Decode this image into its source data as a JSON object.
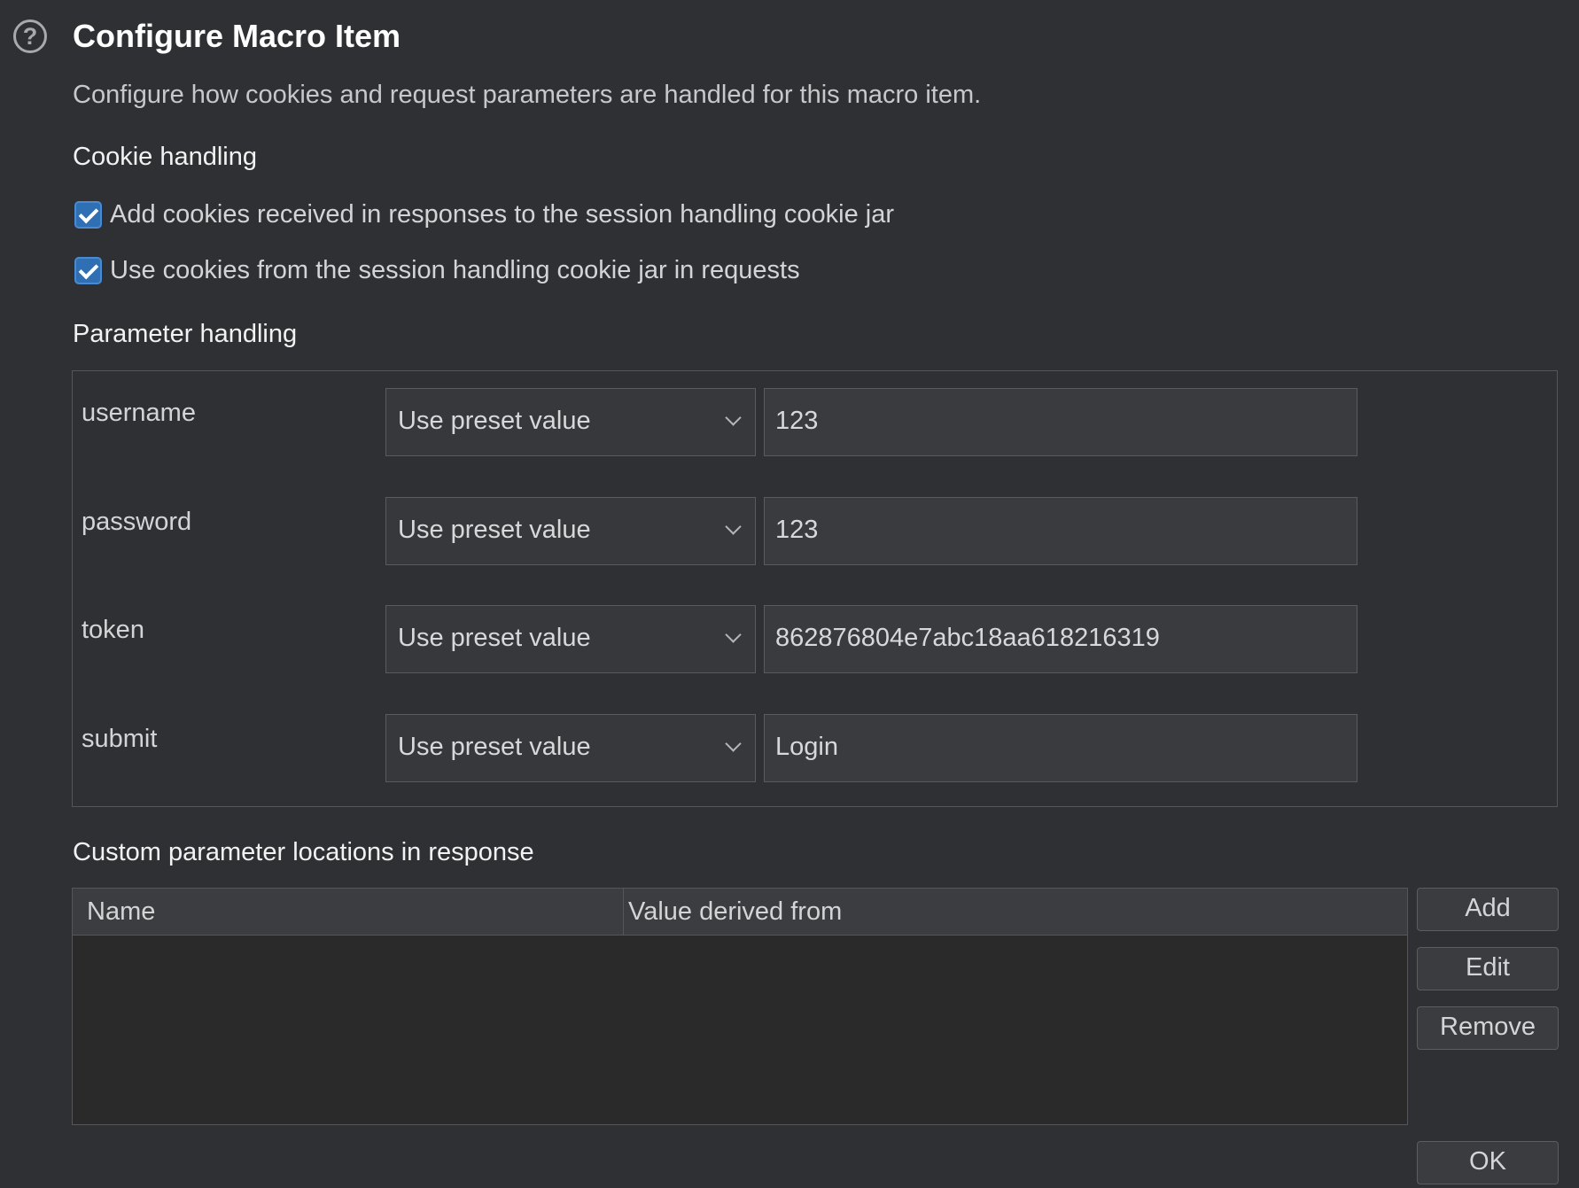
{
  "dialog": {
    "title": "Configure Macro Item",
    "subtitle": "Configure how cookies and request parameters are handled for this macro item."
  },
  "cookie_handling": {
    "heading": "Cookie handling",
    "options": [
      {
        "label": "Add cookies received in responses to the session handling cookie jar",
        "checked": true
      },
      {
        "label": "Use cookies from the session handling cookie jar in requests",
        "checked": true
      }
    ]
  },
  "parameter_handling": {
    "heading": "Parameter handling",
    "rows": [
      {
        "name": "username",
        "mode": "Use preset value",
        "value": "123"
      },
      {
        "name": "password",
        "mode": "Use preset value",
        "value": "123"
      },
      {
        "name": "token",
        "mode": "Use preset value",
        "value": "862876804e7abc18aa618216319"
      },
      {
        "name": "submit",
        "mode": "Use preset value",
        "value": "Login"
      }
    ]
  },
  "custom_locations": {
    "heading": "Custom parameter locations in response",
    "columns": [
      "Name",
      "Value derived from"
    ],
    "rows": []
  },
  "buttons": {
    "add": "Add",
    "edit": "Edit",
    "remove": "Remove",
    "ok": "OK"
  },
  "colors": {
    "background": "#2f3033",
    "checkbox_accent": "#2f6fb3"
  },
  "icons": {
    "help": "help-icon",
    "checkbox_check": "check-icon",
    "dropdown": "chevron-down-icon"
  }
}
